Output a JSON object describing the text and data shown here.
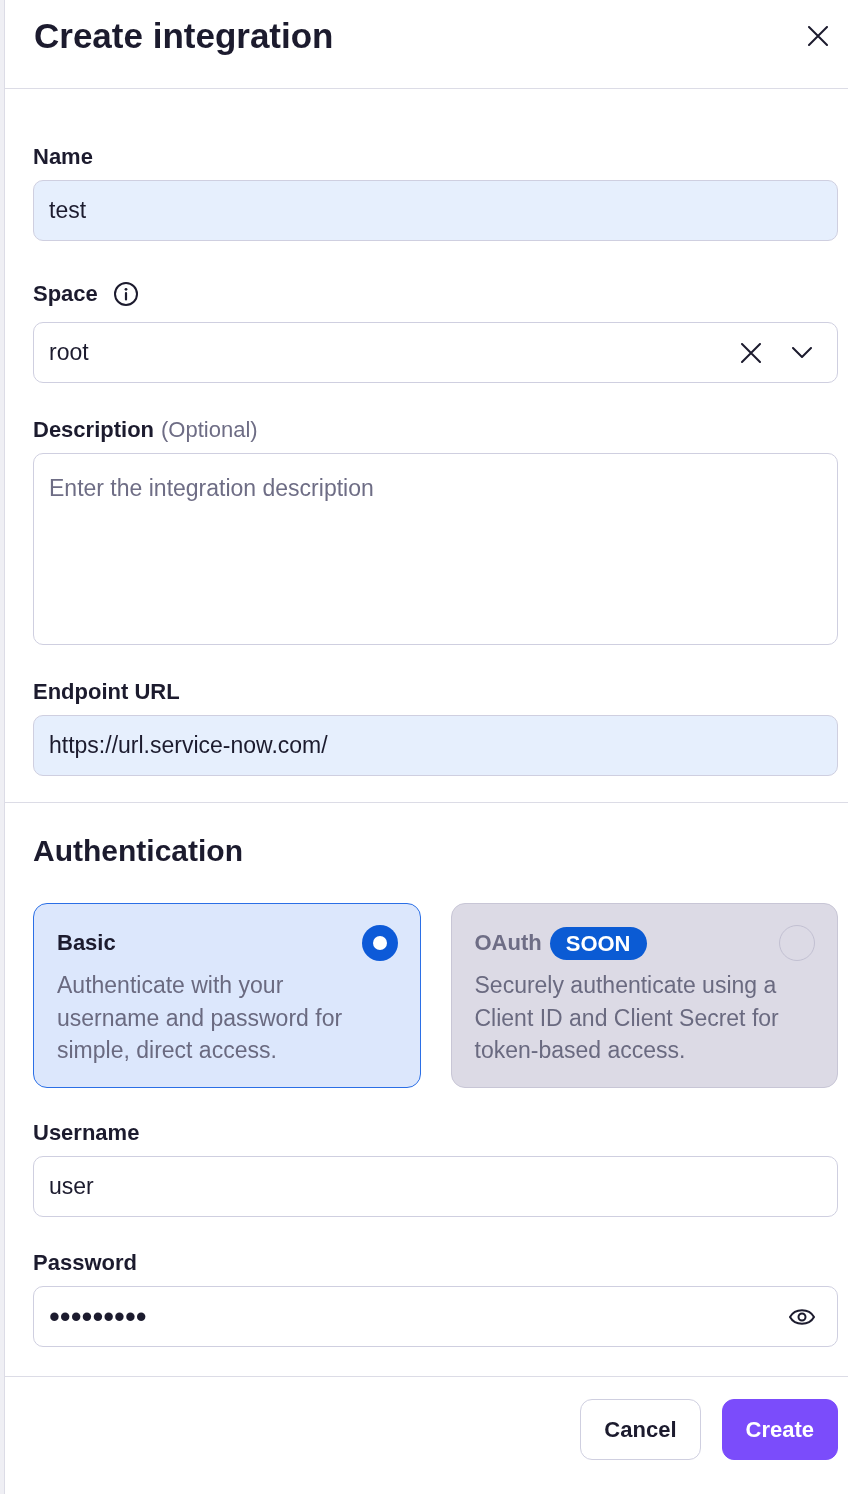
{
  "header": {
    "title": "Create integration"
  },
  "details": {
    "fields": [
      {
        "kind": "text",
        "label": "Name",
        "value": "test",
        "autofilled": true,
        "info": false
      },
      {
        "kind": "select",
        "label": "Space",
        "value": "root",
        "autofilled": false,
        "info": true
      },
      {
        "kind": "textarea",
        "label": "Description",
        "hint": "(Optional)",
        "placeholder": "Enter the integration description",
        "autofilled": false,
        "info": false
      },
      {
        "kind": "text",
        "label": "Endpoint URL",
        "value": "https://url.service-now.com/",
        "autofilled": true,
        "info": false
      }
    ]
  },
  "authentication": {
    "title": "Authentication",
    "options": [
      {
        "title": "Basic",
        "description": "Authenticate with your username and password for simple, direct access.",
        "selected": true,
        "disabled": false
      },
      {
        "title": "OAuth",
        "badge": "SOON",
        "description": "Securely authenticate using a Client ID and Client Secret for token-based access.",
        "selected": false,
        "disabled": true
      }
    ],
    "fields": [
      {
        "kind": "text",
        "label": "Username",
        "value": "user",
        "autofilled": false,
        "info": false
      },
      {
        "kind": "password",
        "label": "Password",
        "value": "•••••••••",
        "autofilled": false,
        "info": false
      }
    ]
  },
  "footer": {
    "buttons": [
      {
        "label": "Cancel",
        "kind": "secondary"
      },
      {
        "label": "Create",
        "kind": "primary"
      }
    ]
  }
}
